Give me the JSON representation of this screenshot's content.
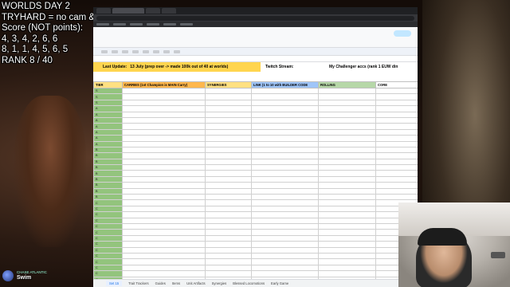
{
  "overlay": {
    "line1": "WORLDS DAY 2",
    "line2": "TRYHARD = no cam & mic",
    "line3": "Score (NOT points):",
    "line4": "4, 3, 4, 2, 6, 6",
    "line5": "8, 1, 1, 4, 5, 6, 5",
    "line6": "RANK 8 / 40"
  },
  "sheet": {
    "last_update_label": "Last Update:",
    "last_update_text": "13 July (prep over -> made 100k out of 40 at worlds)",
    "twitch_label": "Twitch Stream:",
    "challenger_label": "My Challenger accs (rank 1 EUW din",
    "headers": {
      "tier": "TIER",
      "carries": "CARRIES (1st Champion is MAIN Carry)",
      "synergies": "SYNERGIES",
      "link": "LINK (1 to 10 with BUILDER CODE",
      "rolling": "ROLLING",
      "core": "CORE"
    },
    "rows": [
      {
        "tier": "S",
        "carries": "",
        "syn": "",
        "link": "",
        "roll": "",
        "core": ""
      },
      {
        "tier": "S",
        "carries": "",
        "syn": "",
        "link": "",
        "roll": "",
        "core": ""
      },
      {
        "tier": "S",
        "carries": "",
        "syn": "",
        "link": "",
        "roll": "",
        "core": ""
      },
      {
        "tier": "A",
        "carries": "",
        "syn": "",
        "link": "",
        "roll": "",
        "core": ""
      },
      {
        "tier": "A",
        "carries": "",
        "syn": "",
        "link": "",
        "roll": "",
        "core": ""
      },
      {
        "tier": "A",
        "carries": "",
        "syn": "",
        "link": "",
        "roll": "",
        "core": ""
      },
      {
        "tier": "A",
        "carries": "",
        "syn": "",
        "link": "",
        "roll": "",
        "core": ""
      },
      {
        "tier": "A",
        "carries": "",
        "syn": "",
        "link": "",
        "roll": "",
        "core": ""
      },
      {
        "tier": "A",
        "carries": "",
        "syn": "",
        "link": "",
        "roll": "",
        "core": ""
      },
      {
        "tier": "A",
        "carries": "",
        "syn": "",
        "link": "",
        "roll": "",
        "core": ""
      },
      {
        "tier": "B",
        "carries": "",
        "syn": "",
        "link": "",
        "roll": "",
        "core": ""
      },
      {
        "tier": "B",
        "carries": "",
        "syn": "",
        "link": "",
        "roll": "",
        "core": ""
      },
      {
        "tier": "B",
        "carries": "",
        "syn": "",
        "link": "",
        "roll": "",
        "core": ""
      },
      {
        "tier": "B",
        "carries": "",
        "syn": "",
        "link": "",
        "roll": "",
        "core": ""
      },
      {
        "tier": "B",
        "carries": "",
        "syn": "",
        "link": "",
        "roll": "",
        "core": ""
      },
      {
        "tier": "B",
        "carries": "",
        "syn": "",
        "link": "",
        "roll": "",
        "core": ""
      },
      {
        "tier": "B",
        "carries": "",
        "syn": "",
        "link": "",
        "roll": "",
        "core": ""
      },
      {
        "tier": "B",
        "carries": "",
        "syn": "",
        "link": "",
        "roll": "",
        "core": ""
      },
      {
        "tier": "B",
        "carries": "",
        "syn": "",
        "link": "",
        "roll": "",
        "core": ""
      },
      {
        "tier": "C",
        "carries": "",
        "syn": "",
        "link": "",
        "roll": "",
        "core": ""
      },
      {
        "tier": "C",
        "carries": "",
        "syn": "",
        "link": "",
        "roll": "",
        "core": ""
      },
      {
        "tier": "C",
        "carries": "",
        "syn": "",
        "link": "",
        "roll": "",
        "core": ""
      },
      {
        "tier": "C",
        "carries": "",
        "syn": "",
        "link": "",
        "roll": "",
        "core": ""
      },
      {
        "tier": "C",
        "carries": "",
        "syn": "",
        "link": "",
        "roll": "",
        "core": ""
      },
      {
        "tier": "C",
        "carries": "",
        "syn": "",
        "link": "",
        "roll": "",
        "core": ""
      },
      {
        "tier": "C",
        "carries": "",
        "syn": "",
        "link": "",
        "roll": "",
        "core": ""
      },
      {
        "tier": "C",
        "carries": "",
        "syn": "",
        "link": "",
        "roll": "",
        "core": ""
      },
      {
        "tier": "C",
        "carries": "",
        "syn": "",
        "link": "",
        "roll": "",
        "core": ""
      },
      {
        "tier": "C",
        "carries": "",
        "syn": "",
        "link": "",
        "roll": "",
        "core": ""
      },
      {
        "tier": "C",
        "carries": "",
        "syn": "",
        "link": "",
        "roll": "",
        "core": ""
      },
      {
        "tier": "C",
        "carries": "",
        "syn": "",
        "link": "",
        "roll": "",
        "core": ""
      },
      {
        "tier": "C",
        "carries": "",
        "syn": "",
        "link": "",
        "roll": "",
        "core": ""
      },
      {
        "tier": "C",
        "carries": "",
        "syn": "",
        "link": "",
        "roll": "",
        "core": ""
      },
      {
        "tier": "C",
        "carries": "",
        "syn": "",
        "link": "",
        "roll": "",
        "core": ""
      }
    ],
    "tabs": [
      "Set 15",
      "Trait Trackers",
      "Guides",
      "Items",
      "Unit Artifacts",
      "Synergies",
      "Blessed Locomotions",
      "Early Game"
    ]
  },
  "streamer": {
    "small": "CHASE ATLANTIC",
    "name": "Swim"
  }
}
